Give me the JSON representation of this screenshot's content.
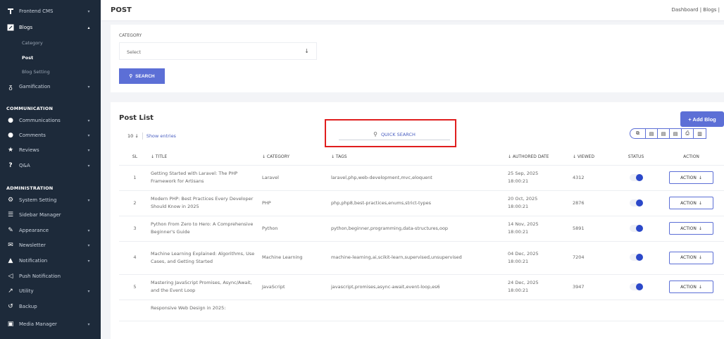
{
  "sidebar": {
    "items": [
      {
        "label": "Frontend CMS",
        "icon": "frontend-cms-icon",
        "glyph": "P̄"
      },
      {
        "label": "Blogs",
        "icon": "blogs-icon",
        "glyph": "✎"
      },
      {
        "label": "Gamification",
        "icon": "gamification-icon",
        "glyph": "♉"
      },
      {
        "label": "Communications",
        "icon": "communications-icon",
        "glyph": "💬"
      },
      {
        "label": "Comments",
        "icon": "comments-icon",
        "glyph": "●"
      },
      {
        "label": "Reviews",
        "icon": "reviews-icon",
        "glyph": "★"
      },
      {
        "label": "Q&A",
        "icon": "qa-icon",
        "glyph": "?"
      },
      {
        "label": "System Setting",
        "icon": "system-setting-icon",
        "glyph": "⚙"
      },
      {
        "label": "Sidebar Manager",
        "icon": "sidebar-manager-icon",
        "glyph": "☰"
      },
      {
        "label": "Appearance",
        "icon": "appearance-icon",
        "glyph": "✎"
      },
      {
        "label": "Newsletter",
        "icon": "newsletter-icon",
        "glyph": "✉"
      },
      {
        "label": "Notification",
        "icon": "notification-icon",
        "glyph": "🔔"
      },
      {
        "label": "Push Notification",
        "icon": "push-notification-icon",
        "glyph": "📢"
      },
      {
        "label": "Utility",
        "icon": "utility-icon",
        "glyph": "↗"
      },
      {
        "label": "Backup",
        "icon": "backup-icon",
        "glyph": "↺"
      },
      {
        "label": "Media Manager",
        "icon": "media-manager-icon",
        "glyph": "▣"
      }
    ],
    "blog_subitems": [
      "Category",
      "Post",
      "Blog Setting"
    ],
    "sections": {
      "communication": "COMMUNICATION",
      "administration": "ADMINISTRATION"
    }
  },
  "header": {
    "title": "POST",
    "breadcrumbs": "Dashboard  |  Blogs  |"
  },
  "filter": {
    "category_label": "CATEGORY",
    "category_value": "Select",
    "search_label": "SEARCH"
  },
  "post_list": {
    "title": "Post List",
    "add_label": "+ Add Blog",
    "page_size": "10",
    "show_entries": "Show entries",
    "quick_search": "QUICK SEARCH",
    "columns": {
      "sl": "SL",
      "title": "↓ TITLE",
      "category": "↓ CATEGORY",
      "tags": "↓ TAGS",
      "date": "↓ AUTHORED DATE",
      "viewed": "↓ VIEWED",
      "status": "STATUS",
      "action": "ACTION"
    },
    "action_label": "ACTION",
    "rows": [
      {
        "sl": "1",
        "title": "Getting Started with Laravel: The PHP Framework for Artisans",
        "category": "Laravel",
        "tags": "laravel,php,web-development,mvc,eloquent",
        "date": "25 Sep, 2025",
        "time": "18:00:21",
        "viewed": "4312",
        "status": true
      },
      {
        "sl": "2",
        "title": "Modern PHP: Best Practices Every Developer Should Know in 2025",
        "category": "PHP",
        "tags": "php,php8,best-practices,enums,strict-types",
        "date": "20 Oct, 2025",
        "time": "18:00:21",
        "viewed": "2876",
        "status": true
      },
      {
        "sl": "3",
        "title": "Python From Zero to Hero: A Comprehensive Beginner's Guide",
        "category": "Python",
        "tags": "python,beginner,programming,data-structures,oop",
        "date": "14 Nov, 2025",
        "time": "18:00:21",
        "viewed": "5891",
        "status": true
      },
      {
        "sl": "4",
        "title": "Machine Learning Explained: Algorithms, Use Cases, and Getting Started",
        "category": "Machine Learning",
        "tags": "machine-learning,ai,scikit-learn,supervised,unsupervised",
        "date": "04 Dec, 2025",
        "time": "18:00:21",
        "viewed": "7204",
        "status": true
      },
      {
        "sl": "5",
        "title": "Mastering JavaScript Promises, Async/Await, and the Event Loop",
        "category": "JavaScript",
        "tags": "javascript,promises,async-await,event-loop,es6",
        "date": "24 Dec, 2025",
        "time": "18:00:21",
        "viewed": "3947",
        "status": true
      },
      {
        "sl": "",
        "title": "Responsive Web Design in 2025:",
        "category": "",
        "tags": "",
        "date": "",
        "time": "",
        "viewed": "",
        "status": null
      }
    ]
  },
  "colors": {
    "sidebar_bg": "#1d2a3a",
    "accent": "#5c6fd6",
    "highlight_border": "#e01e1e",
    "toggle_on": "#2b48c9"
  }
}
